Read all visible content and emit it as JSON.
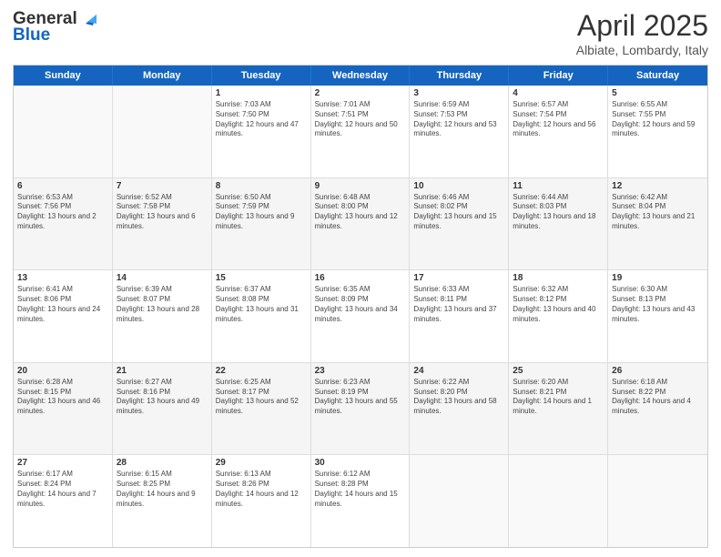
{
  "logo": {
    "general": "General",
    "blue": "Blue"
  },
  "title": "April 2025",
  "subtitle": "Albiate, Lombardy, Italy",
  "headers": [
    "Sunday",
    "Monday",
    "Tuesday",
    "Wednesday",
    "Thursday",
    "Friday",
    "Saturday"
  ],
  "rows": [
    [
      {
        "day": "",
        "text": "",
        "empty": true
      },
      {
        "day": "",
        "text": "",
        "empty": true
      },
      {
        "day": "1",
        "text": "Sunrise: 7:03 AM\nSunset: 7:50 PM\nDaylight: 12 hours and 47 minutes."
      },
      {
        "day": "2",
        "text": "Sunrise: 7:01 AM\nSunset: 7:51 PM\nDaylight: 12 hours and 50 minutes."
      },
      {
        "day": "3",
        "text": "Sunrise: 6:59 AM\nSunset: 7:53 PM\nDaylight: 12 hours and 53 minutes."
      },
      {
        "day": "4",
        "text": "Sunrise: 6:57 AM\nSunset: 7:54 PM\nDaylight: 12 hours and 56 minutes."
      },
      {
        "day": "5",
        "text": "Sunrise: 6:55 AM\nSunset: 7:55 PM\nDaylight: 12 hours and 59 minutes."
      }
    ],
    [
      {
        "day": "6",
        "text": "Sunrise: 6:53 AM\nSunset: 7:56 PM\nDaylight: 13 hours and 2 minutes."
      },
      {
        "day": "7",
        "text": "Sunrise: 6:52 AM\nSunset: 7:58 PM\nDaylight: 13 hours and 6 minutes."
      },
      {
        "day": "8",
        "text": "Sunrise: 6:50 AM\nSunset: 7:59 PM\nDaylight: 13 hours and 9 minutes."
      },
      {
        "day": "9",
        "text": "Sunrise: 6:48 AM\nSunset: 8:00 PM\nDaylight: 13 hours and 12 minutes."
      },
      {
        "day": "10",
        "text": "Sunrise: 6:46 AM\nSunset: 8:02 PM\nDaylight: 13 hours and 15 minutes."
      },
      {
        "day": "11",
        "text": "Sunrise: 6:44 AM\nSunset: 8:03 PM\nDaylight: 13 hours and 18 minutes."
      },
      {
        "day": "12",
        "text": "Sunrise: 6:42 AM\nSunset: 8:04 PM\nDaylight: 13 hours and 21 minutes."
      }
    ],
    [
      {
        "day": "13",
        "text": "Sunrise: 6:41 AM\nSunset: 8:06 PM\nDaylight: 13 hours and 24 minutes."
      },
      {
        "day": "14",
        "text": "Sunrise: 6:39 AM\nSunset: 8:07 PM\nDaylight: 13 hours and 28 minutes."
      },
      {
        "day": "15",
        "text": "Sunrise: 6:37 AM\nSunset: 8:08 PM\nDaylight: 13 hours and 31 minutes."
      },
      {
        "day": "16",
        "text": "Sunrise: 6:35 AM\nSunset: 8:09 PM\nDaylight: 13 hours and 34 minutes."
      },
      {
        "day": "17",
        "text": "Sunrise: 6:33 AM\nSunset: 8:11 PM\nDaylight: 13 hours and 37 minutes."
      },
      {
        "day": "18",
        "text": "Sunrise: 6:32 AM\nSunset: 8:12 PM\nDaylight: 13 hours and 40 minutes."
      },
      {
        "day": "19",
        "text": "Sunrise: 6:30 AM\nSunset: 8:13 PM\nDaylight: 13 hours and 43 minutes."
      }
    ],
    [
      {
        "day": "20",
        "text": "Sunrise: 6:28 AM\nSunset: 8:15 PM\nDaylight: 13 hours and 46 minutes."
      },
      {
        "day": "21",
        "text": "Sunrise: 6:27 AM\nSunset: 8:16 PM\nDaylight: 13 hours and 49 minutes."
      },
      {
        "day": "22",
        "text": "Sunrise: 6:25 AM\nSunset: 8:17 PM\nDaylight: 13 hours and 52 minutes."
      },
      {
        "day": "23",
        "text": "Sunrise: 6:23 AM\nSunset: 8:19 PM\nDaylight: 13 hours and 55 minutes."
      },
      {
        "day": "24",
        "text": "Sunrise: 6:22 AM\nSunset: 8:20 PM\nDaylight: 13 hours and 58 minutes."
      },
      {
        "day": "25",
        "text": "Sunrise: 6:20 AM\nSunset: 8:21 PM\nDaylight: 14 hours and 1 minute."
      },
      {
        "day": "26",
        "text": "Sunrise: 6:18 AM\nSunset: 8:22 PM\nDaylight: 14 hours and 4 minutes."
      }
    ],
    [
      {
        "day": "27",
        "text": "Sunrise: 6:17 AM\nSunset: 8:24 PM\nDaylight: 14 hours and 7 minutes."
      },
      {
        "day": "28",
        "text": "Sunrise: 6:15 AM\nSunset: 8:25 PM\nDaylight: 14 hours and 9 minutes."
      },
      {
        "day": "29",
        "text": "Sunrise: 6:13 AM\nSunset: 8:26 PM\nDaylight: 14 hours and 12 minutes."
      },
      {
        "day": "30",
        "text": "Sunrise: 6:12 AM\nSunset: 8:28 PM\nDaylight: 14 hours and 15 minutes."
      },
      {
        "day": "",
        "text": "",
        "empty": true
      },
      {
        "day": "",
        "text": "",
        "empty": true
      },
      {
        "day": "",
        "text": "",
        "empty": true
      }
    ]
  ]
}
